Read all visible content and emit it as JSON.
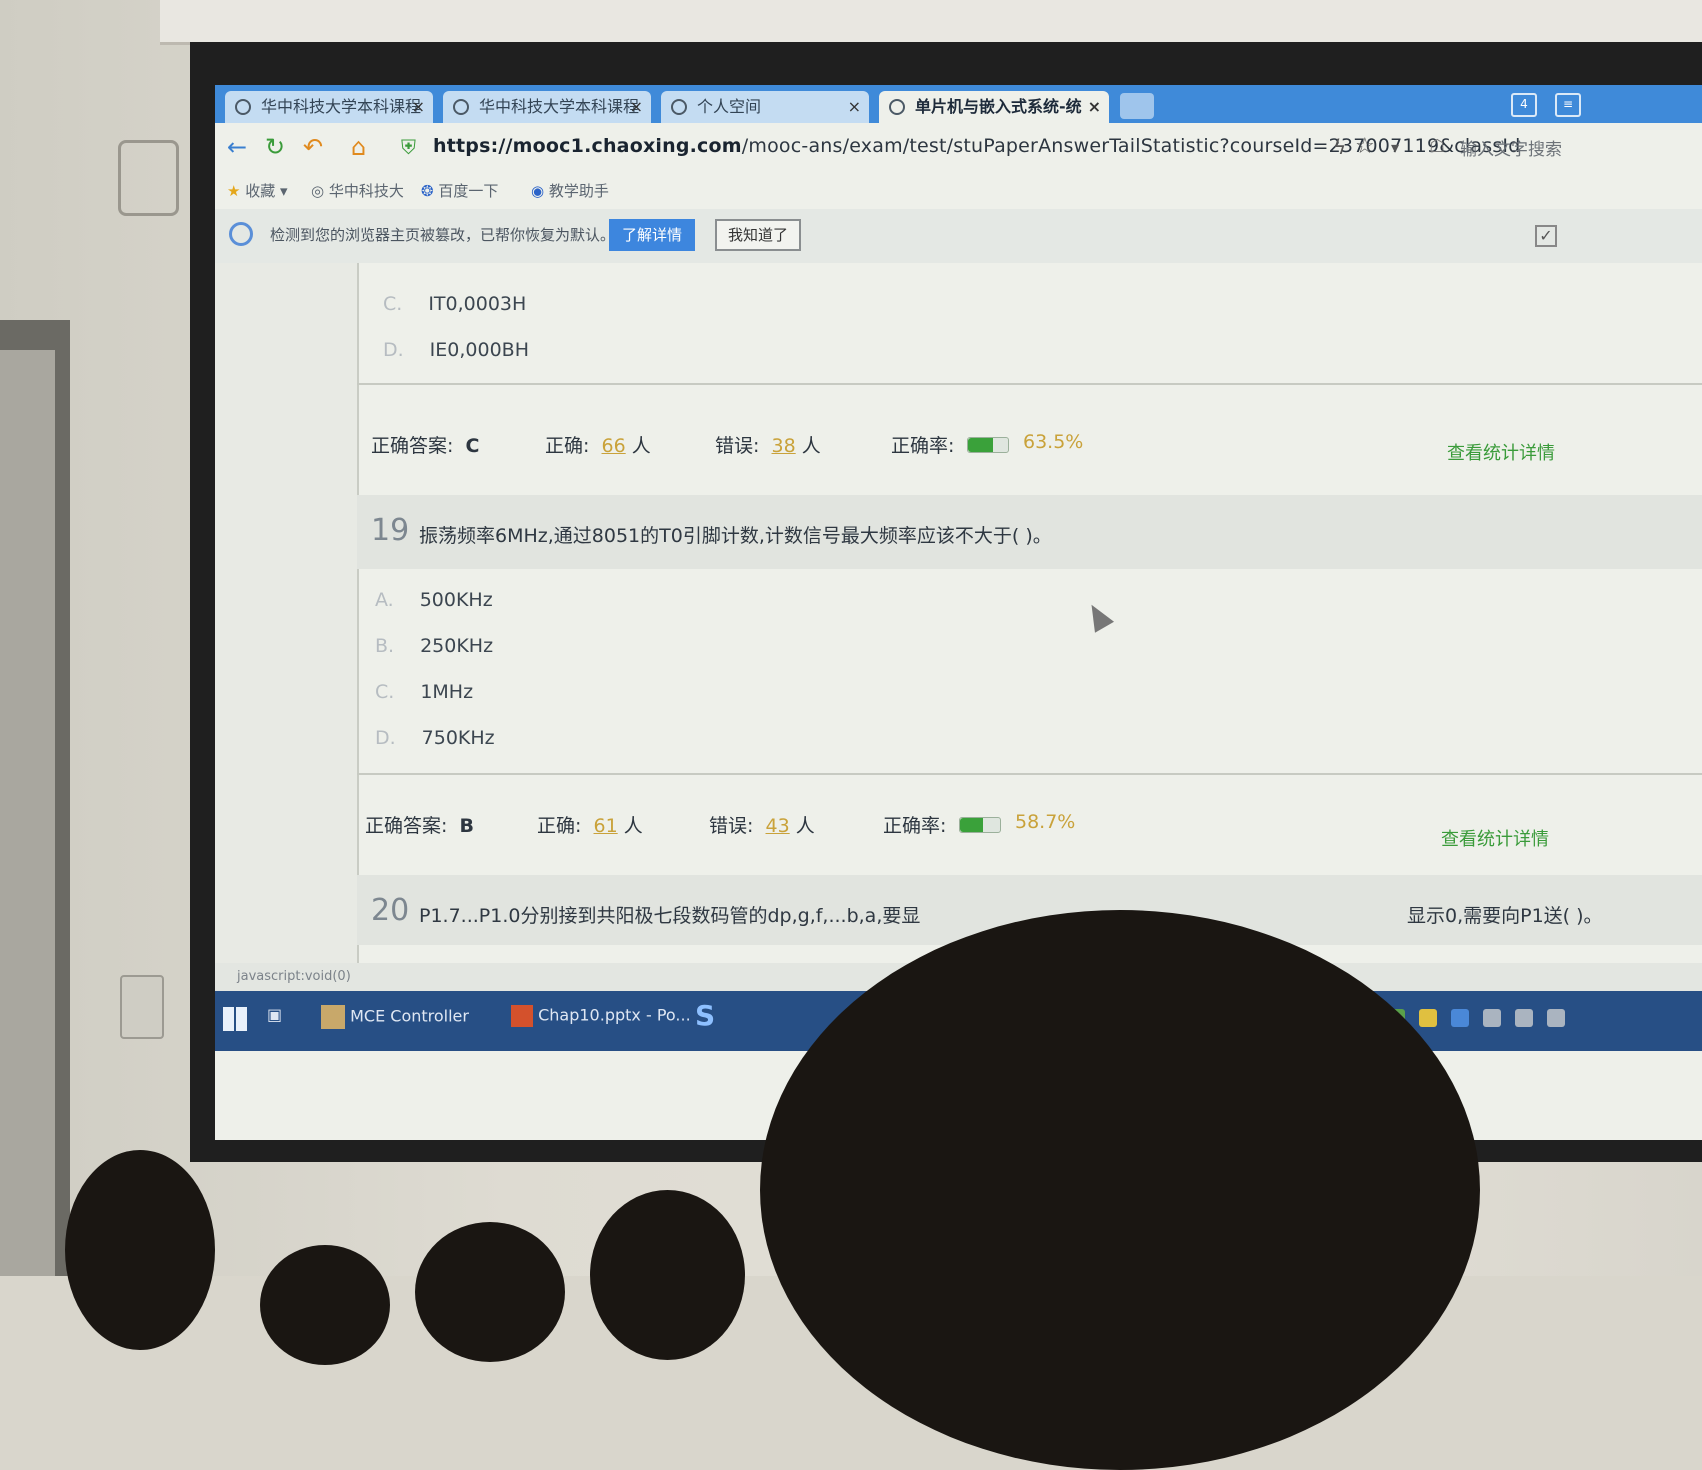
{
  "browser": {
    "tabs": [
      {
        "label": "华中科技大学本科课程",
        "icon": "globe-icon"
      },
      {
        "label": "华中科技大学本科课程",
        "icon": "globe-icon"
      },
      {
        "label": "个人空间",
        "icon": "globe-icon"
      },
      {
        "label": "单片机与嵌入式系统-统",
        "icon": "globe-icon",
        "active": true
      }
    ],
    "url_host": "https://mooc1.chaoxing.com",
    "url_path": "/mooc-ans/exam/test/stuPaperAnswerTailStatistic?courseId=237007119&classId",
    "search_placeholder": "输入文字搜索",
    "bookmarks": [
      "收藏",
      "华中科技大",
      "百度一下",
      "教学助手"
    ],
    "notice_text": "检测到您的浏览器主页被篡改，已帮你恢复为默认。",
    "notice_btn_details": "了解详情",
    "notice_btn_ok": "我知道了",
    "status_text": "javascript:void(0)"
  },
  "question_prev": {
    "options": [
      {
        "letter": "C.",
        "text": "IT0,0003H"
      },
      {
        "letter": "D.",
        "text": "IE0,000BH"
      }
    ],
    "stats": {
      "answer_label": "正确答案:",
      "answer": "C",
      "correct_label": "正确:",
      "correct": "66",
      "wrong_label": "错误:",
      "wrong": "38",
      "unit": "人",
      "rate_label": "正确率:",
      "rate": "63.5%",
      "rate_value": 0.635,
      "detail_link": "查看统计详情"
    }
  },
  "question_19": {
    "number": "19",
    "text": "振荡频率6MHz,通过8051的T0引脚计数,计数信号最大频率应该不大于( )。",
    "options": [
      {
        "letter": "A.",
        "text": "500KHz"
      },
      {
        "letter": "B.",
        "text": "250KHz"
      },
      {
        "letter": "C.",
        "text": "1MHz"
      },
      {
        "letter": "D.",
        "text": "750KHz"
      }
    ],
    "stats": {
      "answer_label": "正确答案:",
      "answer": "B",
      "correct_label": "正确:",
      "correct": "61",
      "wrong_label": "错误:",
      "wrong": "43",
      "unit": "人",
      "rate_label": "正确率:",
      "rate": "58.7%",
      "rate_value": 0.587,
      "detail_link": "查看统计详情"
    }
  },
  "question_20": {
    "number": "20",
    "text_start": "P1.7...P1.0分别接到共阳极七段数码管的dp,g,f,...b,a,要显",
    "text_end": "显示0,需要向P1送( )。"
  },
  "taskbar": {
    "items": [
      "MCE Controller",
      "Chap10.pptx - Po..."
    ]
  }
}
